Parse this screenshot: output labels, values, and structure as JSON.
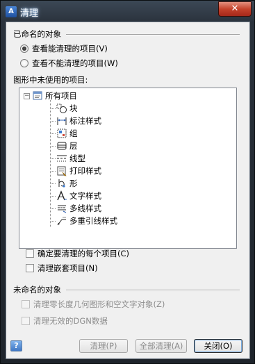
{
  "window": {
    "title": "清理",
    "app_icon": "autocad-icon",
    "close_glyph": "✕"
  },
  "named_objects": {
    "group_label": "已命名的对象",
    "radio_view_purgeable": "查看能清理的项目(V)",
    "radio_view_non_purgeable": "查看不能清理的项目(W)",
    "selected_radio": "radio_view_purgeable",
    "tree_label": "图形中未使用的项目:",
    "tree_root": "所有项目",
    "tree_items": [
      {
        "label": "块",
        "icon": "block-icon"
      },
      {
        "label": "标注样式",
        "icon": "dimension-style-icon"
      },
      {
        "label": "组",
        "icon": "group-icon"
      },
      {
        "label": "层",
        "icon": "layer-icon"
      },
      {
        "label": "线型",
        "icon": "linetype-icon"
      },
      {
        "label": "打印样式",
        "icon": "plot-style-icon"
      },
      {
        "label": "形",
        "icon": "shape-icon"
      },
      {
        "label": "文字样式",
        "icon": "text-style-icon"
      },
      {
        "label": "多线样式",
        "icon": "multiline-style-icon"
      },
      {
        "label": "多重引线样式",
        "icon": "multileader-style-icon"
      }
    ],
    "confirm_each_label": "确定要清理的每个项目(C)",
    "purge_nested_label": "清理嵌套项目(N)"
  },
  "unnamed_objects": {
    "group_label": "未命名的对象",
    "purge_zero_length_label": "清理零长度几何图形和空文字对象(Z)",
    "purge_dgn_label": "清理无效的DGN数据"
  },
  "footer": {
    "help_glyph": "?",
    "purge_button": "清理(P)",
    "purge_all_button": "全部清理(A)",
    "close_button": "关闭(O)"
  }
}
